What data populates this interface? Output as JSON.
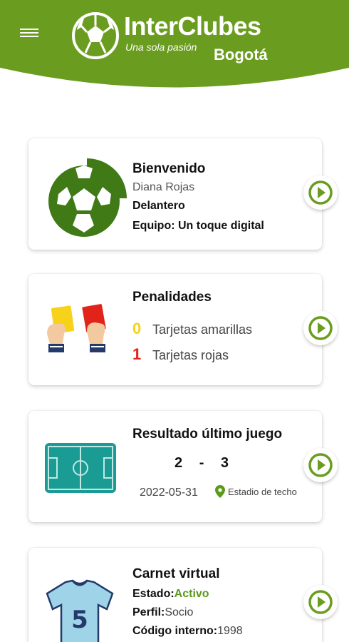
{
  "colors": {
    "brand_green": "#6a9d1f",
    "yellow_card": "#f6d21b",
    "red_card": "#e2231a",
    "pitch": "#1a9c94",
    "active": "#5b9a1a"
  },
  "header": {
    "menu_icon": "hamburger-icon",
    "logo": {
      "brand": "InterClubes",
      "tagline": "Una sola pasión",
      "city": "Bogotá"
    }
  },
  "welcome_card": {
    "icon": "soccer-ball-icon",
    "title": "Bienvenido",
    "name": "Diana Rojas",
    "position": "Delantero",
    "team": "Equipo: Un toque digital"
  },
  "penalties_card": {
    "icon": "referee-cards-icon",
    "title": "Penalidades",
    "yellow_count": "0",
    "yellow_label": "Tarjetas amarillas",
    "red_count": "1",
    "red_label": "Tarjetas rojas"
  },
  "result_card": {
    "icon": "soccer-field-icon",
    "title": "Resultado último juego",
    "home_score": "2",
    "separator": "-",
    "away_score": "3",
    "date": "2022-05-31",
    "venue": "Estadio de techo"
  },
  "carnet_card": {
    "icon": "jersey-icon",
    "jersey_number": "5",
    "title": "Carnet virtual",
    "status_label": "Estado:",
    "status_value": "Activo",
    "profile_label": "Perfil:",
    "profile_value": "Socio",
    "code_label": "Código interno:",
    "code_value": "1998"
  },
  "action_icon": "play-circle-icon"
}
